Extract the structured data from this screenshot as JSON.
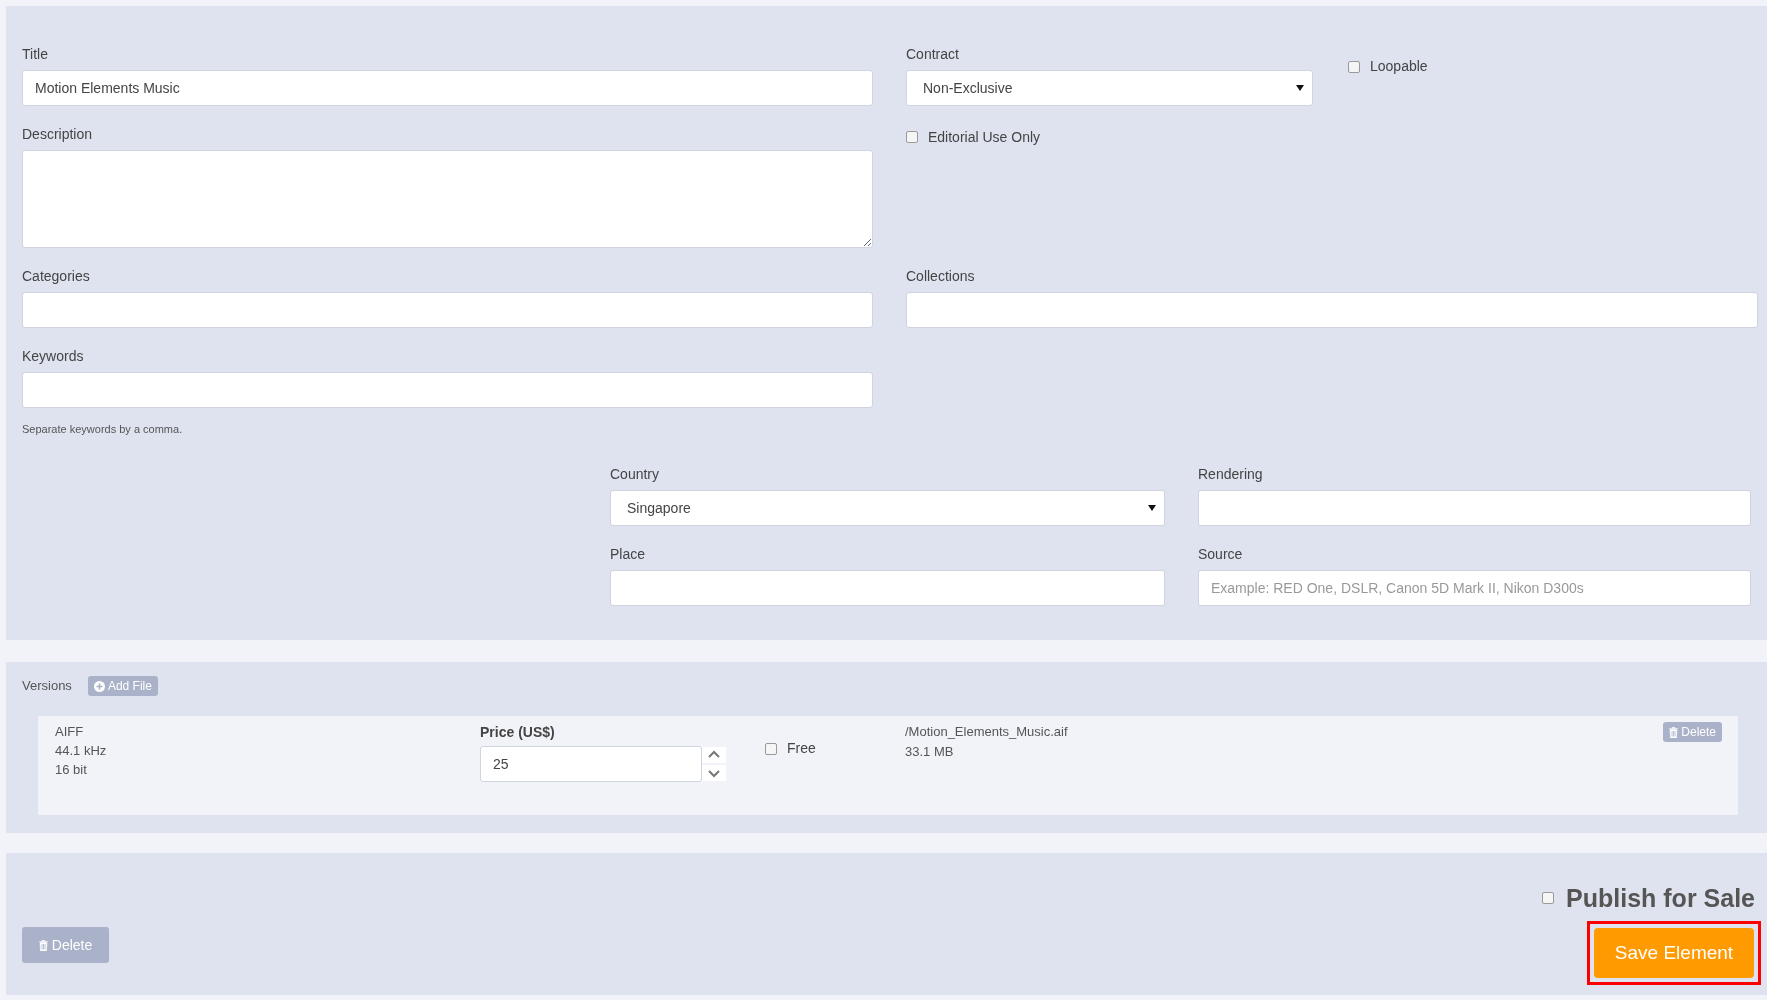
{
  "form": {
    "title": {
      "label": "Title",
      "value": "Motion Elements Music"
    },
    "contract": {
      "label": "Contract",
      "value": "Non-Exclusive"
    },
    "loopable": {
      "label": "Loopable",
      "checked": false
    },
    "description": {
      "label": "Description"
    },
    "editorial_use_only": {
      "label": "Editorial Use Only",
      "checked": false
    },
    "categories": {
      "label": "Categories"
    },
    "collections": {
      "label": "Collections"
    },
    "keywords": {
      "label": "Keywords",
      "hint": "Separate keywords by a comma."
    },
    "country": {
      "label": "Country",
      "value": "Singapore"
    },
    "rendering": {
      "label": "Rendering"
    },
    "place": {
      "label": "Place"
    },
    "source": {
      "label": "Source",
      "placeholder": "Example: RED One, DSLR, Canon 5D Mark II, Nikon D300s"
    }
  },
  "versions": {
    "label": "Versions",
    "add_button": "Add File",
    "items": [
      {
        "format": "AIFF",
        "sample_rate": "44.1 kHz",
        "bit_depth": "16 bit",
        "price_label": "Price (US$)",
        "price": "25",
        "free": {
          "label": "Free",
          "checked": false
        },
        "file_path": "/Motion_Elements_Music.aif",
        "file_size": "33.1 MB",
        "delete_button": "Delete"
      }
    ]
  },
  "footer": {
    "delete_button": "Delete",
    "publish": {
      "label": "Publish for Sale",
      "checked": false
    },
    "save_button": "Save Element",
    "highlighted": true
  }
}
